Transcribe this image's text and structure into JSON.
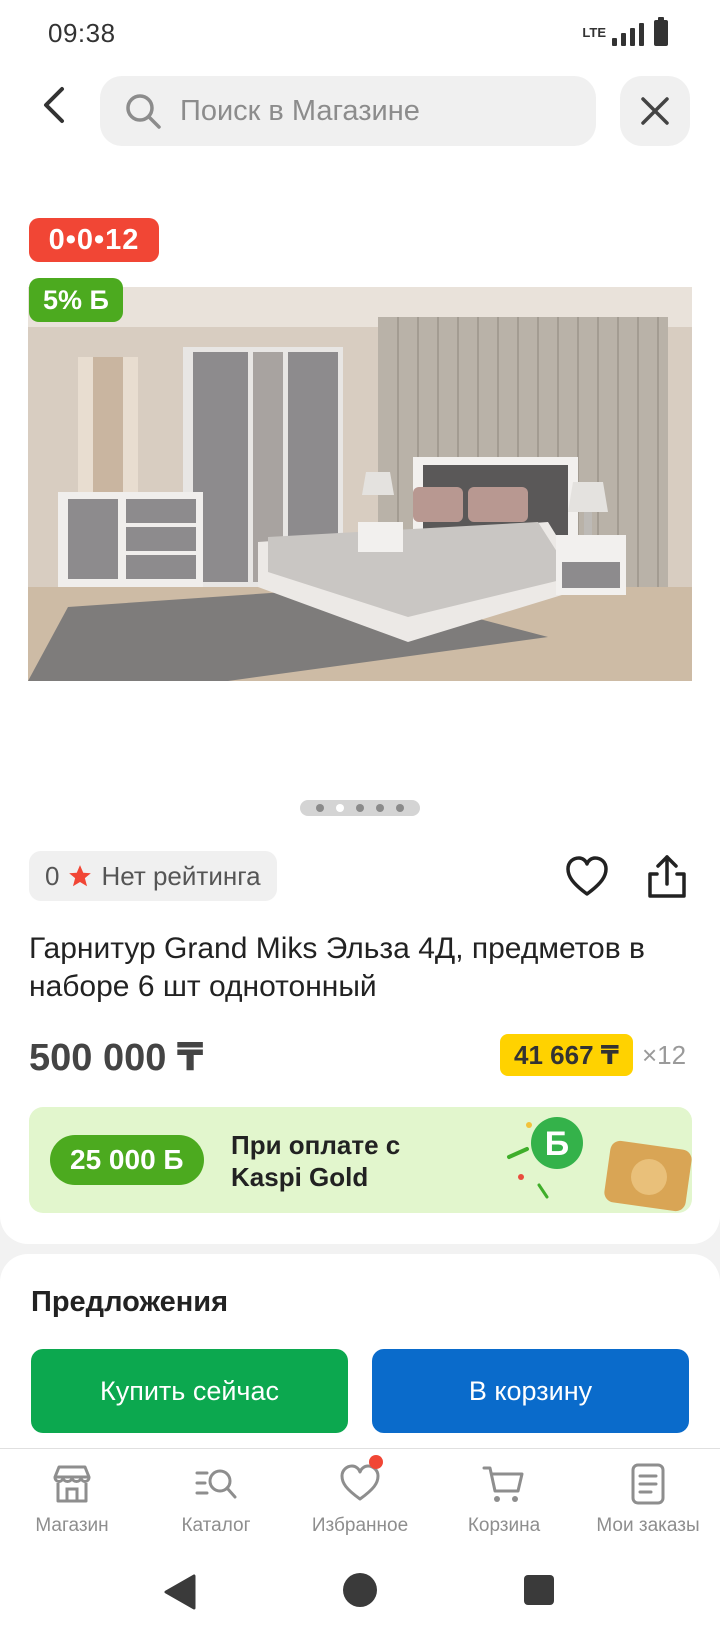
{
  "status_bar": {
    "time": "09:38",
    "network": "LTE"
  },
  "header": {
    "search_placeholder": "Поиск в Магазине",
    "back_icon": "chevron-left-icon",
    "close_icon": "close-icon"
  },
  "badges": {
    "timer": "0•0•12",
    "bonus": "5% Б"
  },
  "gallery": {
    "total_images": 5,
    "active_index": 1
  },
  "rating": {
    "count": "0",
    "label": "Нет рейтинга"
  },
  "product": {
    "title": "Гарнитур Grand Miks Эльза 4Д, предметов в наборе 6 шт однотонный",
    "price": "500 000 ₸",
    "installment_amount": "41 667 ₸",
    "installment_months": "×12"
  },
  "kaspi": {
    "bonus_amount": "25 000 Б",
    "line1": "При оплате с",
    "line2": "Kaspi Gold"
  },
  "offers": {
    "title": "Предложения",
    "buy_now": "Купить сейчас",
    "add_to_cart": "В корзину"
  },
  "bottom_nav": [
    {
      "label": "Магазин",
      "icon": "store-icon"
    },
    {
      "label": "Каталог",
      "icon": "catalog-search-icon"
    },
    {
      "label": "Избранное",
      "icon": "heart-icon"
    },
    {
      "label": "Корзина",
      "icon": "cart-icon"
    },
    {
      "label": "Мои заказы",
      "icon": "orders-icon"
    }
  ],
  "colors": {
    "timer_red": "#f14635",
    "bonus_green": "#4caa1f",
    "buy_green": "#0ca84f",
    "cart_blue": "#0a6bcb",
    "installment_yellow": "#ffd200",
    "kaspi_banner_bg": "#e2f6cd"
  }
}
